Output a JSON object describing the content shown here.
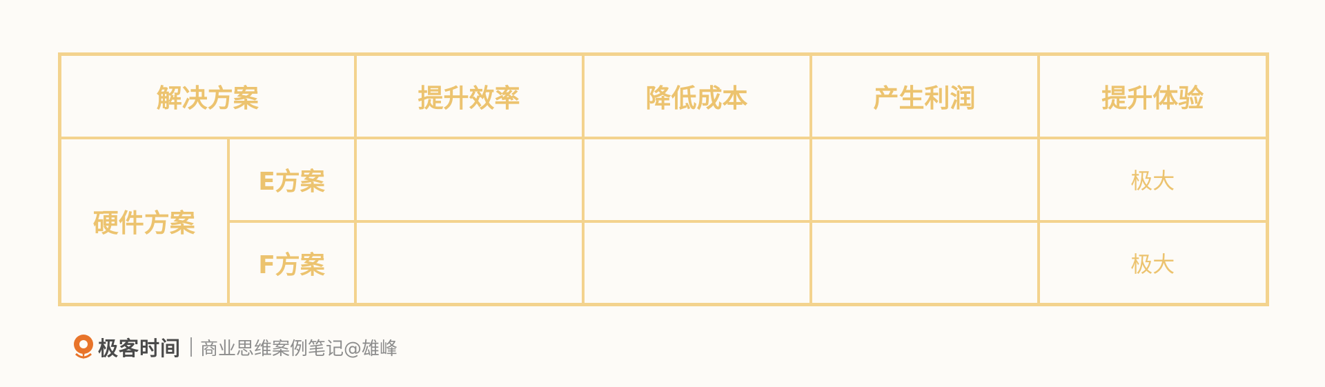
{
  "table": {
    "header": {
      "solution": "解决方案",
      "columns": [
        "提升效率",
        "降低成本",
        "产生利润",
        "提升体验"
      ]
    },
    "group": {
      "label": "硬件方案",
      "rows": [
        {
          "name": "E方案",
          "values": [
            "",
            "",
            "",
            "极大"
          ]
        },
        {
          "name": "F方案",
          "values": [
            "",
            "",
            "",
            "极大"
          ]
        }
      ]
    }
  },
  "footer": {
    "brand": "极客时间",
    "credit": "商业思维案例笔记@雄峰",
    "logo_color": "#e8742a",
    "icon": "geektime-logo-icon"
  },
  "colors": {
    "border": "#f3d38e",
    "text": "#ecc36f",
    "background": "#fdfbf7"
  }
}
